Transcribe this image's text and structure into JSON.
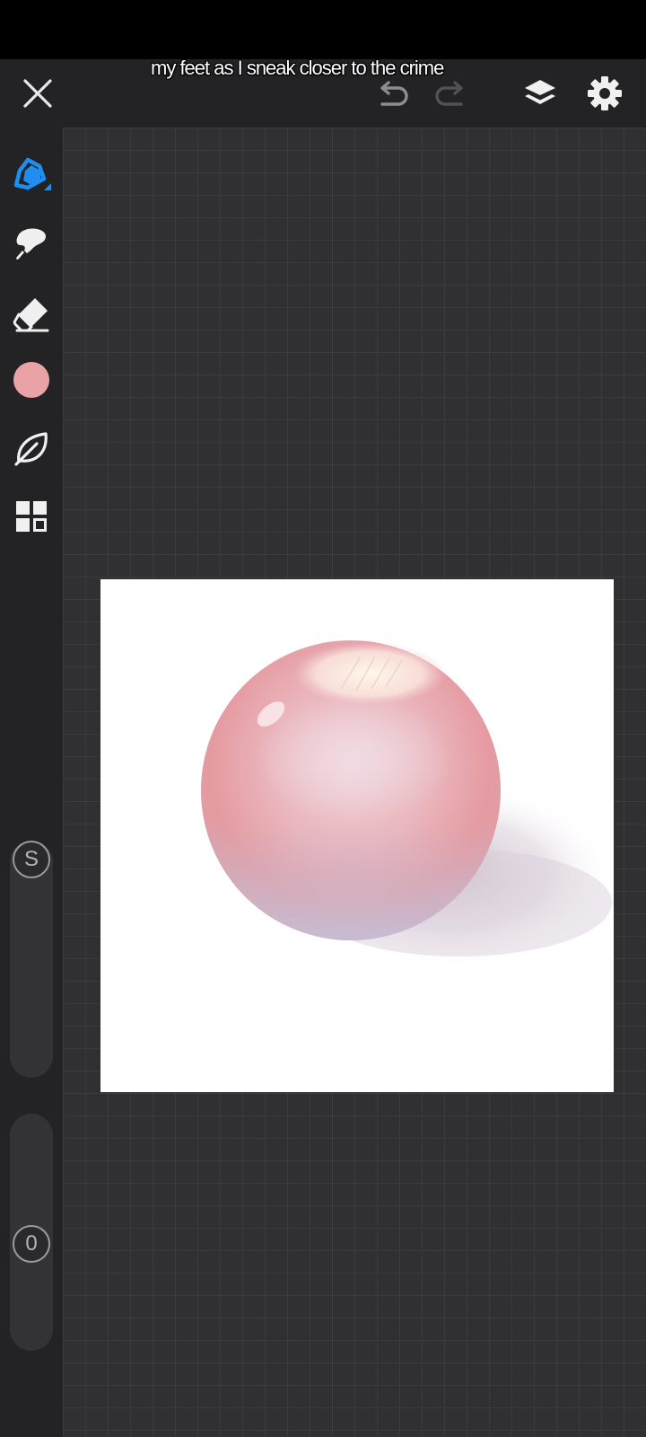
{
  "caption": {
    "text": "my feet as I sneak closer to the crime"
  },
  "toolbar": {
    "close_icon": "close-icon",
    "undo_icon": "undo-icon",
    "redo_icon": "redo-icon",
    "layers_icon": "layers-icon",
    "settings_icon": "gear-icon"
  },
  "tools": [
    {
      "name": "pen-tool",
      "icon": "pen-icon",
      "active": true
    },
    {
      "name": "smudge-tool",
      "icon": "smudge-icon",
      "active": false
    },
    {
      "name": "eraser-tool",
      "icon": "eraser-icon",
      "active": false
    },
    {
      "name": "color-swatch",
      "icon": "color-swatch",
      "color": "#e9a2a6"
    },
    {
      "name": "brush-library",
      "icon": "leaf-icon",
      "active": false
    },
    {
      "name": "more-tools",
      "icon": "grid-icon",
      "active": false
    }
  ],
  "size_slider": {
    "label": "S"
  },
  "opacity_slider": {
    "label": "0"
  },
  "colors": {
    "accent": "#1e8ff0",
    "current_color": "#e9a2a6",
    "toolbar_bg": "#232325",
    "canvas_bg": "#303033"
  }
}
